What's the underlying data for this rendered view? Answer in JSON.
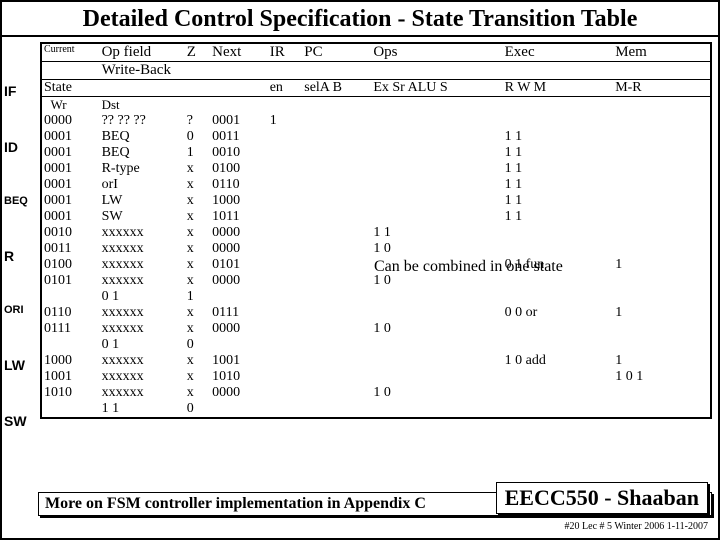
{
  "title": "Detailed Control Specification - State Transition Table",
  "side": [
    "IF",
    "ID",
    "BEQ",
    "R",
    "ORI",
    "LW",
    "SW"
  ],
  "hdr": {
    "current": "Current",
    "op": "Op field",
    "z": "Z",
    "next": "Next",
    "ir": "IR",
    "pc": "PC",
    "ops": "Ops",
    "exec": "Exec",
    "mem": "Mem",
    "wb": "Write-Back"
  },
  "sub": {
    "state": "State",
    "en": "en",
    "selab": "selA B",
    "exsr": "Ex Sr",
    "alu": "ALU",
    "s": "S",
    "rwm": "R W M",
    "mr": "M-R",
    "wr": "Wr",
    "dst": "Dst"
  },
  "rows": [
    {
      "st": "0000",
      "op": "?? ?? ??",
      "z": "?",
      "nx": "0001",
      "ir": "1",
      "pc": "",
      "ops": "",
      "exec": "",
      "mem": ""
    },
    {
      "st": "0001",
      "op": "BEQ",
      "z": "0",
      "nx": "0011",
      "ir": "",
      "pc": "",
      "ops": "",
      "exec": "1 1",
      "mem": ""
    },
    {
      "st": "0001",
      "op": "BEQ",
      "z": "1",
      "nx": "0010",
      "ir": "",
      "pc": "",
      "ops": "",
      "exec": "1 1",
      "mem": ""
    },
    {
      "st": "0001",
      "op": "R-type",
      "z": "x",
      "nx": "0100",
      "ir": "",
      "pc": "",
      "ops": "",
      "exec": "1 1",
      "mem": ""
    },
    {
      "st": "0001",
      "op": "orI",
      "z": "x",
      "nx": "0110",
      "ir": "",
      "pc": "",
      "ops": "",
      "exec": "1 1",
      "mem": ""
    },
    {
      "st": "0001",
      "op": "LW",
      "z": "x",
      "nx": "1000",
      "ir": "",
      "pc": "",
      "ops": "",
      "exec": "1 1",
      "mem": ""
    },
    {
      "st": "0001",
      "op": "SW",
      "z": "x",
      "nx": "1011",
      "ir": "",
      "pc": "",
      "ops": "",
      "exec": "1 1",
      "mem": ""
    },
    {
      "st": "0010",
      "op": "xxxxxx",
      "z": "x",
      "nx": "0000",
      "ir": "",
      "pc": "",
      "ops": "1   1",
      "exec": "",
      "mem": ""
    },
    {
      "st": "0011",
      "op": "xxxxxx",
      "z": "x",
      "nx": "0000",
      "ir": "",
      "pc": "",
      "ops": "1   0",
      "exec": "",
      "mem": ""
    },
    {
      "st": "0100",
      "op": "xxxxxx",
      "z": "x",
      "nx": "0101",
      "ir": "",
      "pc": "",
      "ops": "",
      "exec": "0  1  fun",
      "mem": "1"
    },
    {
      "st": "0101",
      "op": "xxxxxx",
      "z": "x",
      "nx": "0000",
      "ir": "",
      "pc": "",
      "ops": "1   0",
      "exec": "",
      "mem": ""
    },
    {
      "st": "",
      "op": "0   1",
      "z": "1",
      "nx": "",
      "ir": "",
      "pc": "",
      "ops": "",
      "exec": "",
      "mem": ""
    },
    {
      "st": "0110",
      "op": "xxxxxx",
      "z": "x",
      "nx": "0111",
      "ir": "",
      "pc": "",
      "ops": "",
      "exec": "0  0  or",
      "mem": "1"
    },
    {
      "st": "0111",
      "op": "xxxxxx",
      "z": "x",
      "nx": "0000",
      "ir": "",
      "pc": "",
      "ops": "1   0",
      "exec": "",
      "mem": ""
    },
    {
      "st": "",
      "op": "0   1",
      "z": "0",
      "nx": "",
      "ir": "",
      "pc": "",
      "ops": "",
      "exec": "",
      "mem": ""
    },
    {
      "st": "1000",
      "op": "xxxxxx",
      "z": "x",
      "nx": "1001",
      "ir": "",
      "pc": "",
      "ops": "",
      "exec": "1  0  add",
      "mem": "1"
    },
    {
      "st": "1001",
      "op": "xxxxxx",
      "z": "x",
      "nx": "1010",
      "ir": "",
      "pc": "",
      "ops": "",
      "exec": "",
      "mem": "1 0  1"
    },
    {
      "st": "1010",
      "op": "xxxxxx",
      "z": "x",
      "nx": "0000",
      "ir": "",
      "pc": "",
      "ops": "1   0",
      "exec": "",
      "mem": ""
    },
    {
      "st": "",
      "op": "1   1",
      "z": "0",
      "nx": "",
      "ir": "",
      "pc": "",
      "ops": "",
      "exec": "",
      "mem": ""
    }
  ],
  "annot": "Can be combined in one state",
  "footer": "More on FSM controller implementation in Appendix C",
  "course": "EECC550 - Shaaban",
  "date": "#20  Lec # 5  Winter 2006  1-11-2007"
}
